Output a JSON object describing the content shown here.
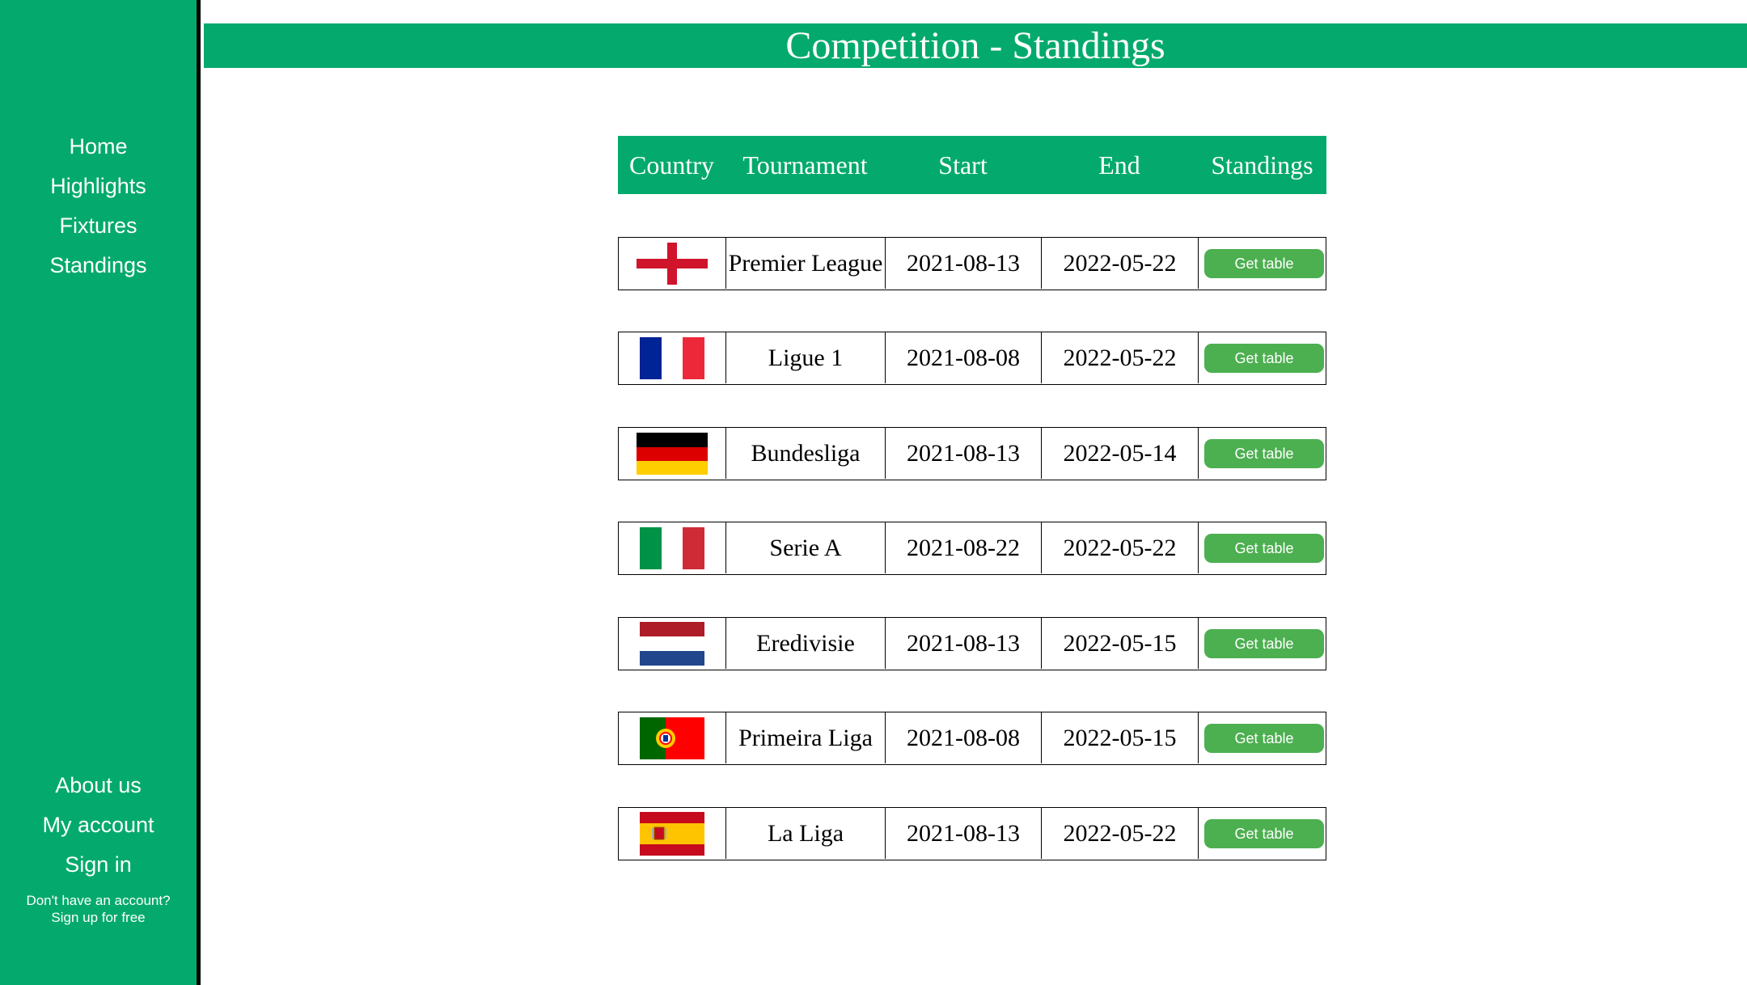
{
  "sidebar": {
    "nav_top": [
      "Home",
      "Highlights",
      "Fixtures",
      "Standings"
    ],
    "nav_bottom": [
      "About us",
      "My account",
      "Sign in"
    ],
    "signup_line1": "Don't have an account?",
    "signup_line2": "Sign up for free",
    "bg_color": "#04aa6d"
  },
  "header": {
    "title": "Competition - Standings"
  },
  "table": {
    "headers": [
      "Country",
      "Tournament",
      "Start",
      "End",
      "Standings"
    ],
    "button_label": "Get table",
    "rows": [
      {
        "flag": "england-flag-icon",
        "tournament": "Premier League",
        "start": "2021-08-13",
        "end": "2022-05-22"
      },
      {
        "flag": "france-flag-icon",
        "tournament": "Ligue 1",
        "start": "2021-08-08",
        "end": "2022-05-22"
      },
      {
        "flag": "germany-flag-icon",
        "tournament": "Bundesliga",
        "start": "2021-08-13",
        "end": "2022-05-14"
      },
      {
        "flag": "italy-flag-icon",
        "tournament": "Serie A",
        "start": "2021-08-22",
        "end": "2022-05-22"
      },
      {
        "flag": "netherlands-flag-icon",
        "tournament": "Eredivisie",
        "start": "2021-08-13",
        "end": "2022-05-15"
      },
      {
        "flag": "portugal-flag-icon",
        "tournament": "Primeira Liga",
        "start": "2021-08-08",
        "end": "2022-05-15"
      },
      {
        "flag": "spain-flag-icon",
        "tournament": "La Liga",
        "start": "2021-08-13",
        "end": "2022-05-22"
      }
    ]
  },
  "colors": {
    "accent": "#04aa6d",
    "button": "#4caf50"
  }
}
